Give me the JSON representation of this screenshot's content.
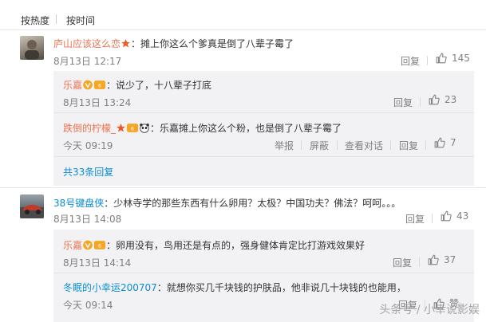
{
  "sort": {
    "hot": "按热度",
    "time": "按时间"
  },
  "comments": [
    {
      "user": "庐山应该这么恋",
      "text": "：摊上你这么个爹真是倒了八辈子霉了",
      "time": "8月13日 12:17",
      "reply_label": "回复",
      "likes": "145",
      "replies": [
        {
          "user": "乐嘉",
          "text": "：说少了，十八辈子打底",
          "time": "8月13日 13:24",
          "reply_label": "回复",
          "likes": "23"
        },
        {
          "user": "跌倒的柠檬_",
          "text": "：乐嘉摊上你这么个粉，也是倒了八辈子霉了",
          "time": "今天 09:19",
          "report": "举报",
          "block": "屏蔽",
          "view": "查看对话",
          "reply_label": "回复",
          "likes": "7"
        }
      ],
      "more": "共33条回复"
    },
    {
      "user": "38号键盘侠",
      "text": "：少林寺学的那些东西有什么卵用？太极？中国功夫？佛法？呵呵。。。",
      "time": "8月13日 14:08",
      "reply_label": "回复",
      "likes": "43",
      "replies": [
        {
          "user": "乐嘉",
          "text": "：卵用没有，鸟用还是有点的，强身健体肯定比打游戏效果好",
          "time": "8月13日 14:14",
          "reply_label": "回复",
          "likes": "37"
        },
        {
          "user": "冬眠的小幸运200707",
          "text": "：就想你买几千块钱的护肤品，他非说几十块钱的也能用，",
          "time": "今天 09:14",
          "reply_label": "回复",
          "likes": "赞"
        }
      ]
    }
  ],
  "watermark": "头条号 / 小幸说影娱",
  "colors": {
    "name": "#eb7350",
    "link": "#0a8cd2",
    "reply_bg": "#f2f2f5"
  }
}
